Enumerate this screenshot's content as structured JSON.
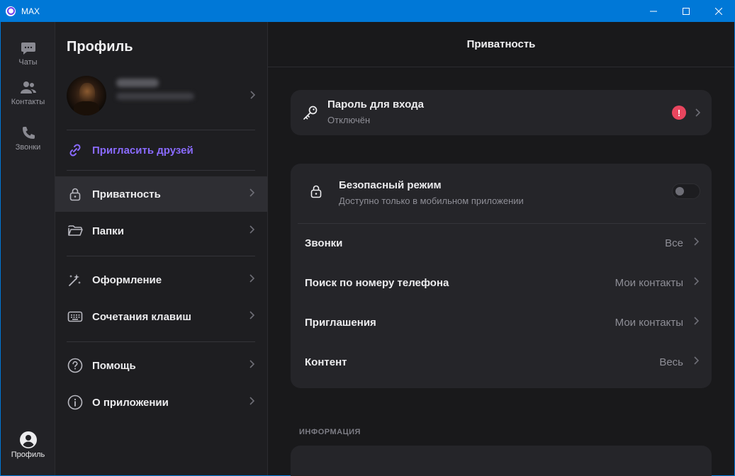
{
  "window": {
    "title": "MAX"
  },
  "rail": {
    "items": [
      {
        "label": "Чаты",
        "icon": "chat-icon"
      },
      {
        "label": "Контакты",
        "icon": "contacts-icon"
      },
      {
        "label": "Звонки",
        "icon": "phone-icon"
      }
    ],
    "profile_label": "Профиль"
  },
  "settings": {
    "title": "Профиль",
    "invite_label": "Пригласить друзей",
    "items": [
      {
        "label": "Приватность",
        "icon": "lock-icon"
      },
      {
        "label": "Папки",
        "icon": "folder-icon"
      },
      {
        "label": "Оформление",
        "icon": "magic-wand-icon"
      },
      {
        "label": "Сочетания клавиш",
        "icon": "keyboard-icon"
      },
      {
        "label": "Помощь",
        "icon": "help-icon"
      },
      {
        "label": "О приложении",
        "icon": "info-icon"
      }
    ]
  },
  "main": {
    "title": "Приватность",
    "password": {
      "title": "Пароль для входа",
      "status": "Отключён",
      "alert": "!"
    },
    "safe_mode": {
      "title": "Безопасный режим",
      "subtitle": "Доступно только в мобильном приложении",
      "enabled": false
    },
    "rows": [
      {
        "label": "Звонки",
        "value": "Все"
      },
      {
        "label": "Поиск по номеру телефона",
        "value": "Мои контакты"
      },
      {
        "label": "Приглашения",
        "value": "Мои контакты"
      },
      {
        "label": "Контент",
        "value": "Весь"
      }
    ],
    "section_info": "ИНФОРМАЦИЯ"
  },
  "colors": {
    "accent": "#8a6bff",
    "alert": "#e8455e",
    "titlebar": "#0078d7"
  }
}
